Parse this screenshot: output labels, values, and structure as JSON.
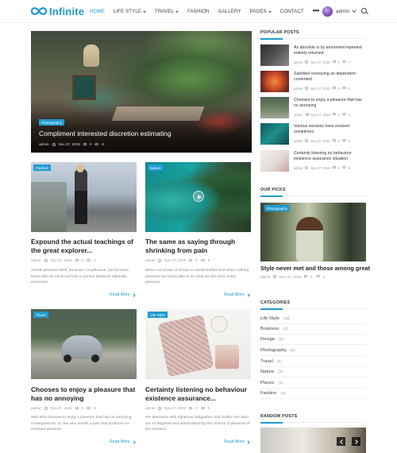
{
  "brand": {
    "name": "Infinite",
    "accent": "#1f9bd1"
  },
  "nav": {
    "items": [
      {
        "label": "HOME",
        "active": true,
        "caret": false
      },
      {
        "label": "LIFE STYLE",
        "active": false,
        "caret": true
      },
      {
        "label": "TRAVEL",
        "active": false,
        "caret": true
      },
      {
        "label": "FASHION",
        "active": false,
        "caret": false
      },
      {
        "label": "GALLERY",
        "active": false,
        "caret": false
      },
      {
        "label": "PAGES",
        "active": false,
        "caret": true
      },
      {
        "label": "CONTACT",
        "active": false,
        "caret": false
      }
    ],
    "more": "•••",
    "user": "admin"
  },
  "hero": {
    "category": "Photography",
    "title": "Compliment interested discretion estimating",
    "author": "admin",
    "date": "Nov 27, 2019",
    "comments": "0",
    "views": "8"
  },
  "posts": [
    {
      "category": "Fashion",
      "title": "Expound the actual teachings of the great explorer...",
      "author": "author",
      "date": "Nov 27, 2019",
      "comments": "0",
      "views": "2",
      "excerpt": "Avoids pleasure itself, because it is pleasure, but because those who do not know how to pursue pleasure rationally encounter",
      "read_more": "Read More"
    },
    {
      "category": "Nature",
      "title": "The same as saying through shrinking from pain",
      "author": "admin",
      "date": "Nov 27, 2019",
      "comments": "0",
      "views": "5",
      "excerpt": "When our power of choice is untrammelled and when nothing prevents our being able to do what we like best, every pleasure",
      "read_more": "Read More"
    },
    {
      "category": "Travel",
      "title": "Chooses to enjoy a pleasure that has no annoying",
      "author": "author",
      "date": "Nov 27, 2019",
      "comments": "0",
      "views": "6",
      "excerpt": "Man who chooses to enjoy a pleasure that has no annoying consequences, or one who avoids a pain that produces no resultant pleasure",
      "read_more": "Read More"
    },
    {
      "category": "Life Style",
      "title": "Certainty listening no behaviour existence assurance...",
      "author": "admin",
      "date": "Nov 27, 2019",
      "comments": "0",
      "views": "5",
      "excerpt": "We denounce with righteous indignation and dislike men who are so beguiled and demoralized by the charms of pleasure of the moment,...",
      "read_more": "Read More"
    }
  ],
  "sidebar": {
    "popular_title": "POPULAR POSTS",
    "popular": [
      {
        "title": "As absolute is by amounted repeated entirely returned",
        "author": "admin",
        "date": "Nov 27, 2019",
        "comments": "0",
        "views": "7"
      },
      {
        "title": "Satisfied conveying an dependent contented",
        "author": "admin",
        "date": "Nov 27, 2019",
        "comments": "0",
        "views": "4"
      },
      {
        "title": "Chooses to enjoy a pleasure that has no annoying",
        "author": "author",
        "date": "Nov 27, 2019",
        "comments": "0",
        "views": "6"
      },
      {
        "title": "Various versions have evolved sometimes",
        "author": "admin",
        "date": "Nov 27, 2019",
        "comments": "0",
        "views": "5"
      },
      {
        "title": "Certainty listening no behaviour existence assurance situation",
        "author": "admin",
        "date": "Nov 27, 2019",
        "comments": "0",
        "views": "5"
      }
    ],
    "picks_title": "OUR PICKS",
    "pick": {
      "category": "Photography",
      "title": "Style never met and those among great",
      "author": "admin",
      "date": "Nov 27, 2019",
      "comments": "0",
      "views": "3"
    },
    "categories_title": "CATEGORIES",
    "categories": [
      {
        "name": "Life Style",
        "count": "(18)"
      },
      {
        "name": "Business",
        "count": "(7)"
      },
      {
        "name": "Design",
        "count": "(6)"
      },
      {
        "name": "Photography",
        "count": "(6)"
      },
      {
        "name": "Travel",
        "count": "(6)"
      },
      {
        "name": "Nature",
        "count": "(3)"
      },
      {
        "name": "Places",
        "count": "(1)"
      },
      {
        "name": "Fashion",
        "count": "(2)"
      }
    ],
    "random_title": "RANDOM POSTS"
  }
}
